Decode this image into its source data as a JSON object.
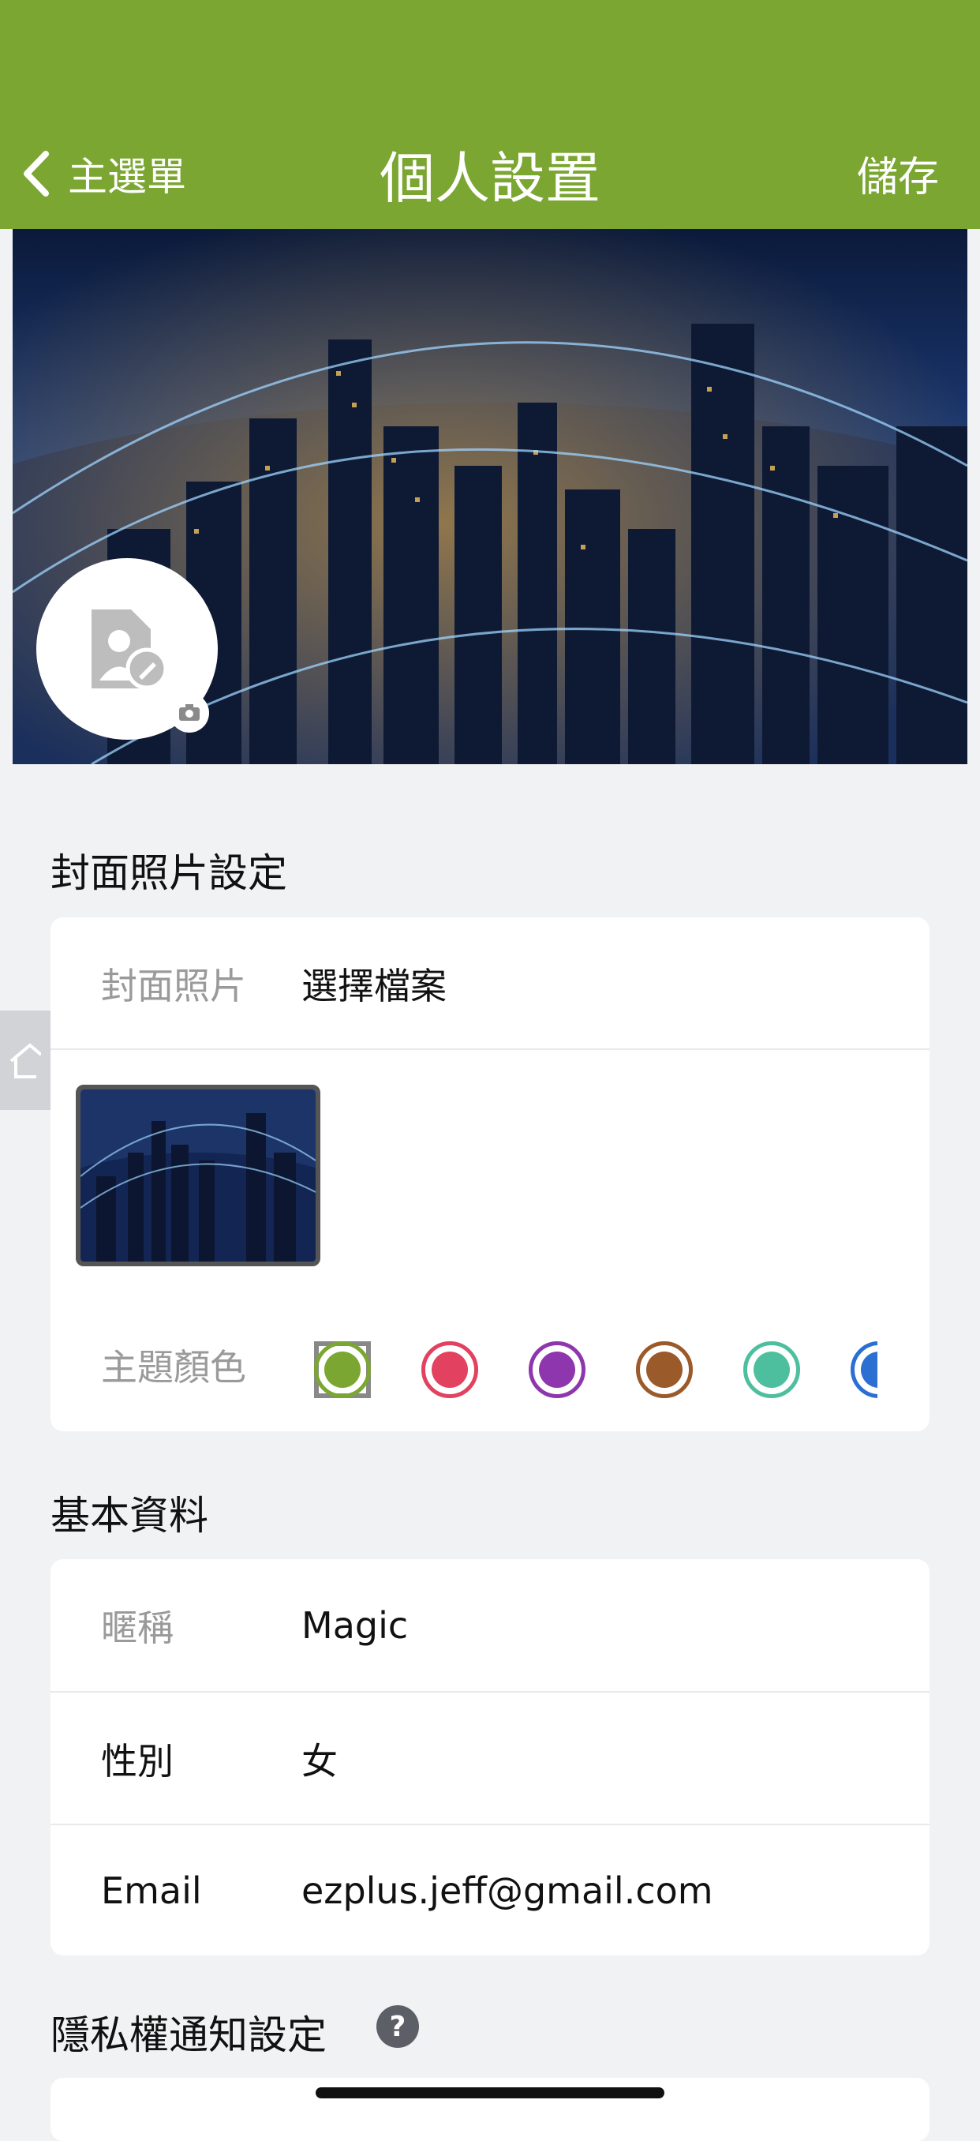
{
  "header": {
    "back_label": "主選單",
    "title": "個人設置",
    "save_label": "儲存",
    "bg_color": "#7ba632"
  },
  "cover_section": {
    "title": "封面照片設定",
    "cover_label": "封面照片",
    "cover_value": "選擇檔案",
    "theme_label": "主題顏色",
    "theme_colors": [
      {
        "name": "green",
        "color": "#7ba632",
        "selected": true
      },
      {
        "name": "red",
        "color": "#e2425f",
        "selected": false
      },
      {
        "name": "purple",
        "color": "#8e36ad",
        "selected": false
      },
      {
        "name": "brown",
        "color": "#9a5a2a",
        "selected": false
      },
      {
        "name": "teal",
        "color": "#4dbf9f",
        "selected": false
      },
      {
        "name": "blue",
        "color": "#2a6fd1",
        "selected": false
      }
    ]
  },
  "basic_section": {
    "title": "基本資料",
    "nickname_label": "暱稱",
    "nickname_value": "Magic",
    "gender_label": "性別",
    "gender_value": "女",
    "email_label": "Email",
    "email_value": "ezplus.jeff@gmail.com"
  },
  "privacy_section": {
    "title": "隱私權通知設定",
    "help_symbol": "?"
  },
  "icons": {
    "back": "chevron-left-icon",
    "avatar": "avatar-edit-icon",
    "camera": "camera-icon",
    "side_tab": "home-icon"
  }
}
